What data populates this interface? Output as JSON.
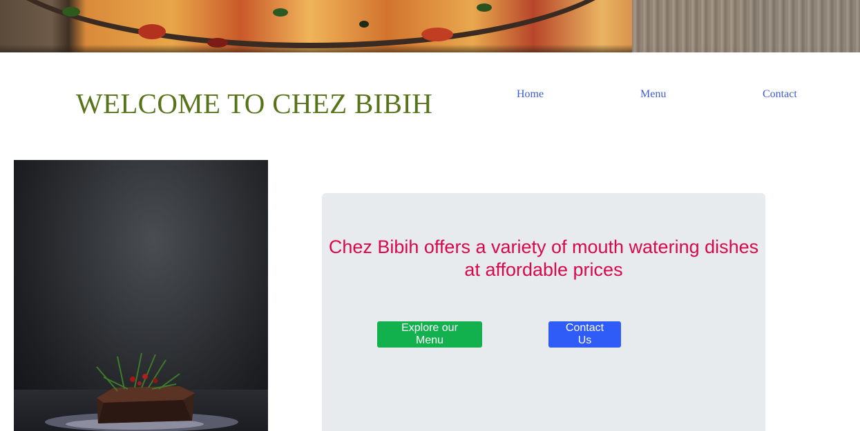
{
  "header": {
    "title": "WELCOME TO CHEZ BIBIH"
  },
  "nav": {
    "items": [
      {
        "label": "Home"
      },
      {
        "label": "Menu"
      },
      {
        "label": "Contact"
      }
    ]
  },
  "hero": {
    "tagline": "Chez Bibih offers a variety of mouth watering dishes at affordable prices",
    "buttons": {
      "explore_label": "Explore our Menu",
      "contact_label": "Contact Us"
    }
  },
  "images": {
    "banner": "pizza-banner-image",
    "side_photo": "cake-photo-image"
  },
  "colors": {
    "title": "#58741b",
    "nav_link": "#3c5bd6",
    "tagline": "#d8084a",
    "explore_button": "#12b14d",
    "contact_button": "#2f5cf6",
    "card_background": "#e8ebee"
  }
}
